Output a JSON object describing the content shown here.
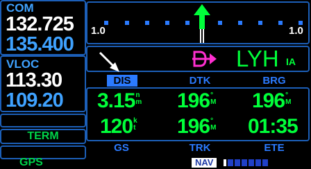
{
  "com": {
    "label": "COM",
    "active": "132.725",
    "standby": "135.400"
  },
  "vloc": {
    "label": "VLOC",
    "active": "113.30",
    "standby": "109.20"
  },
  "softkeys": {
    "term": "TERM",
    "gps": "GPS"
  },
  "cdi": {
    "left_scale": "1.0",
    "right_scale": "1.0"
  },
  "waypoint": {
    "id": "LYH",
    "state": "IA"
  },
  "fields": {
    "headers_top": [
      "DIS",
      "DTK",
      "BRG"
    ],
    "row1": [
      {
        "value": "3.15",
        "unit_top": "n",
        "unit_bot": "m"
      },
      {
        "value": "196",
        "unit_top": "°",
        "unit_bot": "M"
      },
      {
        "value": "196",
        "unit_top": "°",
        "unit_bot": "M"
      }
    ],
    "row2": [
      {
        "value": "120",
        "unit_top": "k",
        "unit_bot": "t"
      },
      {
        "value": "196",
        "unit_top": "°",
        "unit_bot": "M"
      },
      {
        "value": "01:35",
        "unit_top": "",
        "unit_bot": ""
      }
    ],
    "headers_bottom": [
      "GS",
      "TRK",
      "ETE"
    ]
  },
  "nav_bar": {
    "label": "NAV"
  },
  "colors": {
    "accent": "#2b7bff",
    "value": "#00ff3a",
    "magenta": "#ff2fd0",
    "border": "#1c5fb8"
  }
}
